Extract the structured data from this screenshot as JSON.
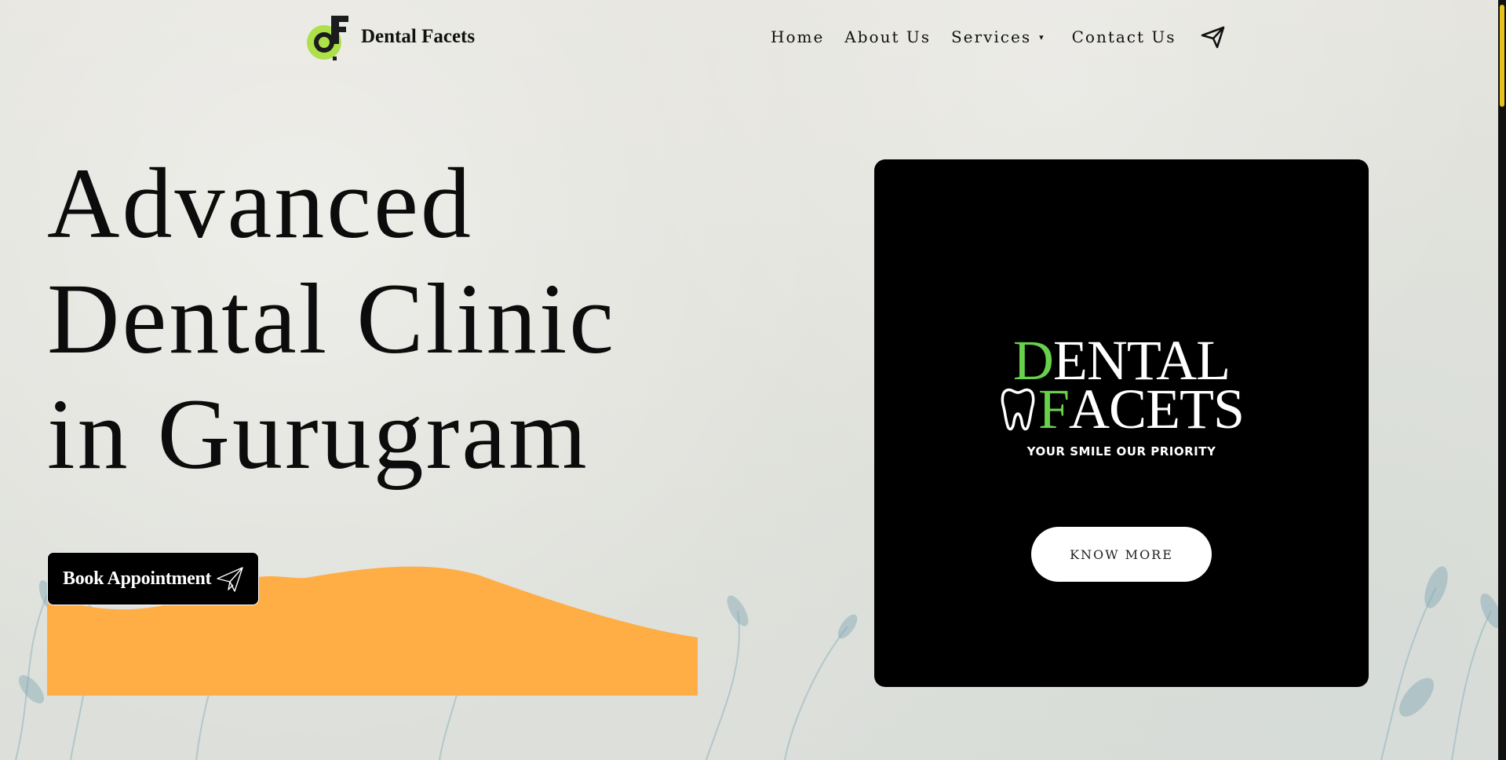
{
  "brand": {
    "name": "Dental Facets",
    "logo_icon": "df-logo-icon"
  },
  "nav": {
    "items": [
      {
        "label": "Home"
      },
      {
        "label": "About Us"
      },
      {
        "label": "Services"
      },
      {
        "label": "Contact Us"
      }
    ],
    "services_caret": "▾",
    "send_icon": "paper-plane-icon"
  },
  "hero": {
    "title_lines": [
      "Advanced",
      "Dental Clinic",
      "in Gurugram"
    ],
    "cta_label": "Book Appointment",
    "cta_icon": "paper-plane-icon"
  },
  "card": {
    "logo_line1_initial": "D",
    "logo_line1_rest": "ENTAL",
    "logo_line2_initial": "F",
    "logo_line2_rest": "ACETS",
    "tagline": "YOUR SMILE OUR PRIORITY",
    "button_label": "KNOW MORE",
    "tooth_icon": "tooth-icon"
  },
  "colors": {
    "background": "#e4e4de",
    "accent_orange": "#ffad45",
    "accent_green": "#67d14b",
    "card_bg": "#000000",
    "scroll_thumb": "#e8c21c"
  }
}
